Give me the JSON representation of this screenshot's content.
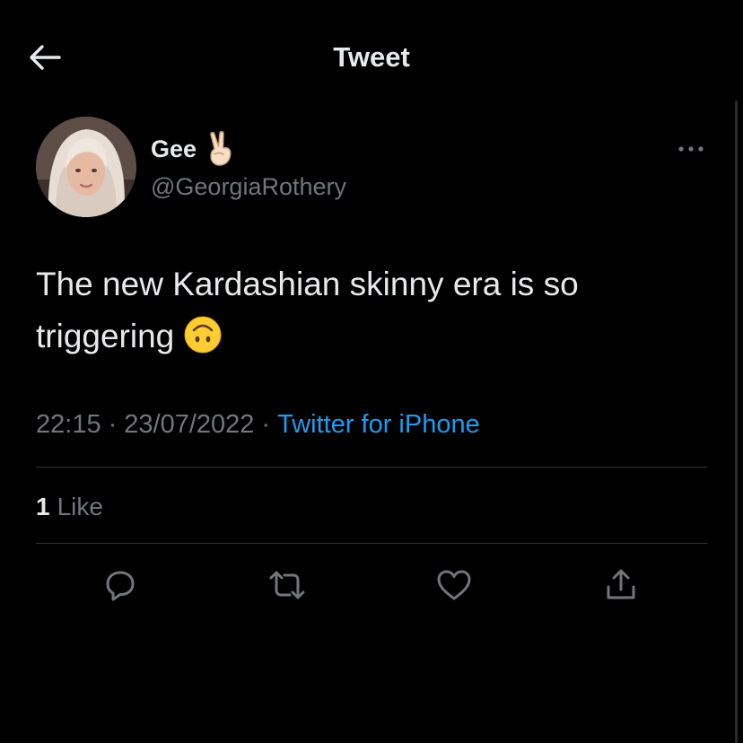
{
  "header": {
    "title": "Tweet",
    "back_icon": "arrow-left-icon"
  },
  "tweet": {
    "display_name": "Gee",
    "name_emoji": "victory-hand-icon",
    "handle": "@GeorgiaRothery",
    "more_icon": "more-horizontal-icon",
    "text": "The new Kardashian skinny era is so triggering",
    "text_emoji": "upside-down-face-icon",
    "time": "22:15",
    "date": "23/07/2022",
    "separator": "·",
    "source": "Twitter for iPhone",
    "like_count": "1",
    "like_label": "Like"
  },
  "actions": [
    {
      "name": "reply",
      "icon": "reply-icon"
    },
    {
      "name": "retweet",
      "icon": "retweet-icon"
    },
    {
      "name": "like",
      "icon": "heart-icon"
    },
    {
      "name": "share",
      "icon": "share-icon"
    }
  ],
  "colors": {
    "background": "#000000",
    "text_primary": "#e7e9ea",
    "text_secondary": "#71767b",
    "link": "#1d9bf0",
    "divider": "#2f3336"
  }
}
